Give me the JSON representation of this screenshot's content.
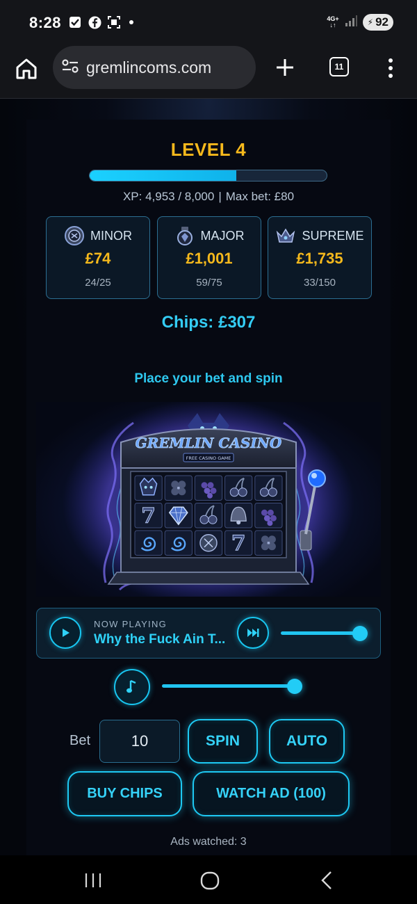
{
  "status_bar": {
    "time": "8:28",
    "network": "4G+",
    "battery": "92"
  },
  "browser": {
    "url": "gremlincoms.com",
    "tab_count": "11"
  },
  "game": {
    "level_title": "LEVEL 4",
    "xp_progress": 0.619,
    "xp_text": "XP: 4,953 / 8,000",
    "separator": "|",
    "max_bet_text": "Max bet: £80",
    "jackpots": [
      {
        "name": "MINOR",
        "amount": "£74",
        "count": "24/25",
        "icon": "coin-icon"
      },
      {
        "name": "MAJOR",
        "amount": "£1,001",
        "count": "59/75",
        "icon": "gem-icon"
      },
      {
        "name": "SUPREME",
        "amount": "£1,735",
        "count": "33/150",
        "icon": "crown-icon"
      }
    ],
    "chips_text": "Chips: £307",
    "prompt": "Place your bet and spin"
  },
  "slot_machine": {
    "title": "GREMLIN CASINO",
    "subtitle": "FREE CASINO GAME",
    "reels": [
      [
        "gremlin",
        "clover",
        "grapes",
        "cherries",
        "cherries"
      ],
      [
        "seven",
        "diamond",
        "cherries",
        "bell",
        "grapes"
      ],
      [
        "swirl",
        "swirl",
        "coin",
        "seven",
        "clover"
      ]
    ]
  },
  "player": {
    "label": "NOW PLAYING",
    "track_title": "Why the Fuck Ain T...",
    "volume": 1.0,
    "music_volume": 1.0
  },
  "controls": {
    "bet_label": "Bet",
    "bet_value": "10",
    "spin_label": "SPIN",
    "auto_label": "AUTO",
    "buy_chips_label": "BUY CHIPS",
    "watch_ad_label": "WATCH AD (100)"
  },
  "footer": {
    "ads_watched_text": "Ads watched: 3"
  },
  "colors": {
    "accent": "#1ec9f3",
    "gold": "#f6b91c",
    "background": "#04060d"
  }
}
